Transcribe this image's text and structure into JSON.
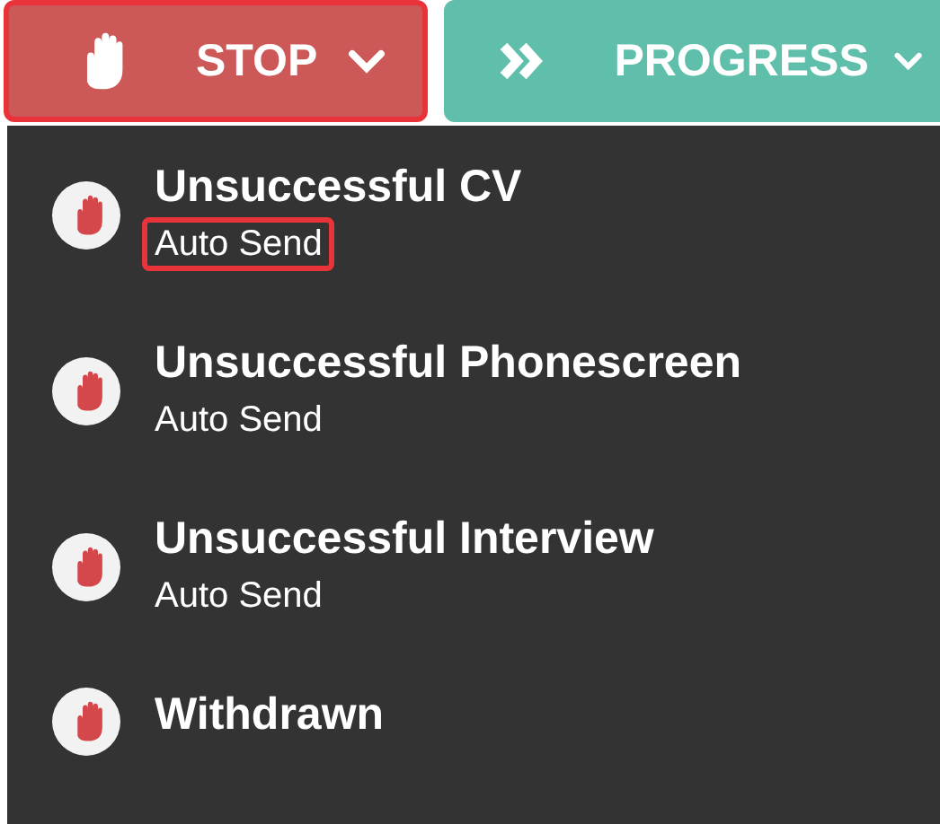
{
  "buttons": [
    {
      "label": "STOP",
      "kind": "stop",
      "outlined": true
    },
    {
      "label": "PROGRESS",
      "kind": "progress",
      "outlined": false
    }
  ],
  "menu": {
    "items": [
      {
        "title": "Unsuccessful CV",
        "subtitle": "Auto Send",
        "subtitle_outlined": true
      },
      {
        "title": "Unsuccessful Phonescreen",
        "subtitle": "Auto Send",
        "subtitle_outlined": false
      },
      {
        "title": "Unsuccessful Interview",
        "subtitle": "Auto Send",
        "subtitle_outlined": false
      },
      {
        "title": "Withdrawn"
      }
    ]
  }
}
